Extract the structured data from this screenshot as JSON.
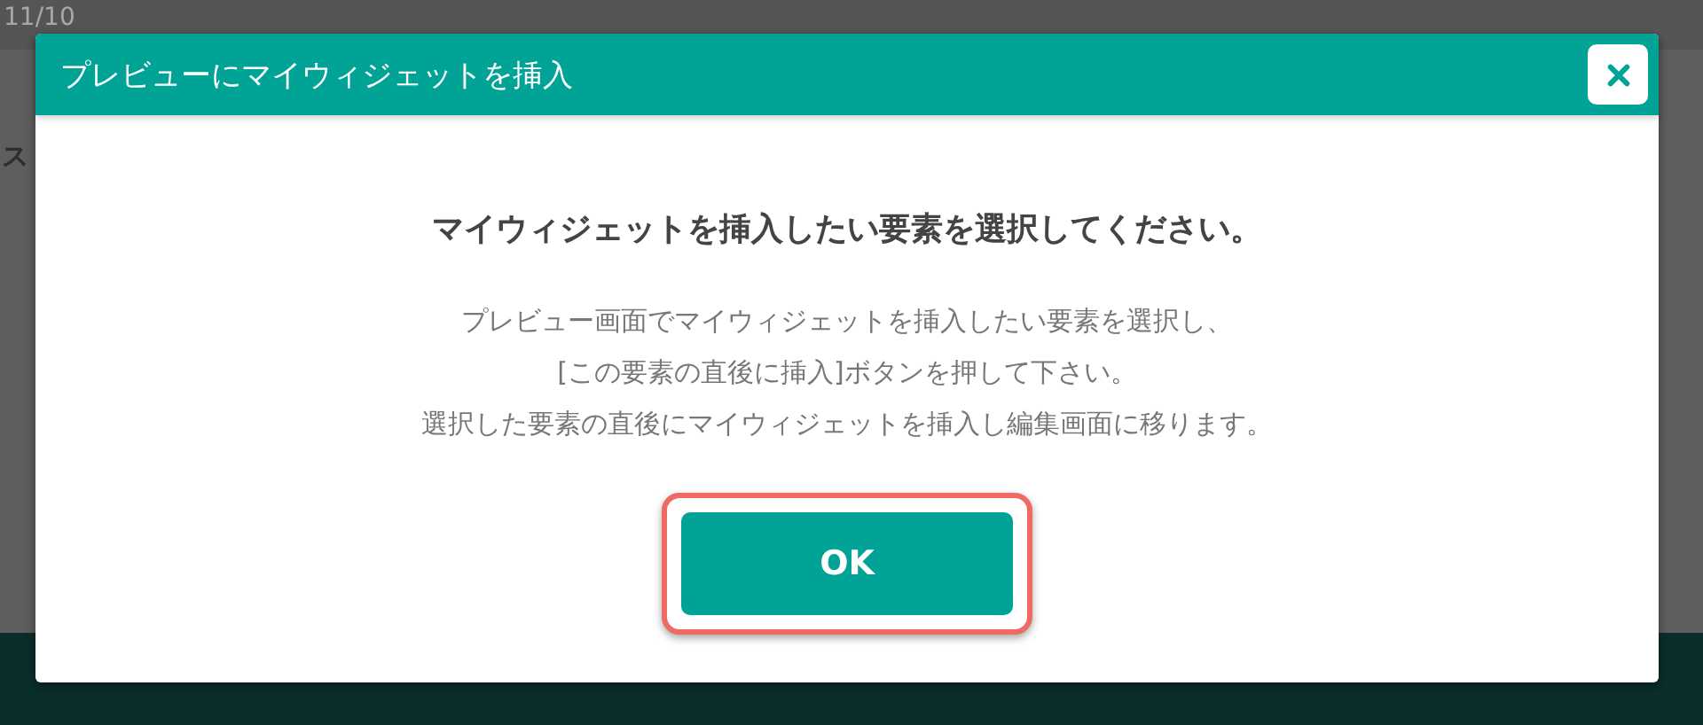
{
  "backdrop": {
    "date": "11/10",
    "label": "ス"
  },
  "dialog": {
    "title": "プレビューにマイウィジェットを挿入",
    "heading": "マイウィジェットを挿入したい要素を選択してください。",
    "lines": [
      "プレビュー画面でマイウィジェットを挿入したい要素を選択し、",
      "[この要素の直後に挿入]ボタンを押して下さい。",
      "選択した要素の直後にマイウィジェットを挿入し編集画面に移ります。"
    ],
    "ok_button": {
      "label": "OK",
      "highlighted": true
    }
  }
}
